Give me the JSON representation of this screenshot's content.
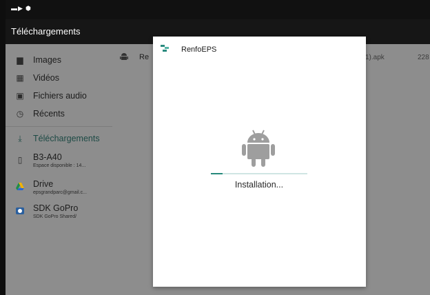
{
  "app_title": "Téléchargements",
  "drawer": {
    "items": [
      {
        "label": "Images",
        "icon": "image-icon"
      },
      {
        "label": "Vidéos",
        "icon": "video-icon"
      },
      {
        "label": "Fichiers audio",
        "icon": "audio-file-icon"
      },
      {
        "label": "Récents",
        "icon": "clock-icon"
      },
      {
        "label": "Téléchargements",
        "icon": "download-icon",
        "active": true
      },
      {
        "label": "B3-A40",
        "sub": "Espace disponible : 14...",
        "icon": "phone-icon"
      },
      {
        "label": "Drive",
        "sub": "epsgrandparc@gmail.c...",
        "icon": "google-drive-icon"
      },
      {
        "label": "SDK GoPro",
        "sub": "SDK GoPro Shared/",
        "icon": "gopro-icon"
      }
    ]
  },
  "file_list": {
    "row": {
      "name_visible": "Re",
      "ext_visible": "1).apk",
      "size_visible": "228",
      "icon": "android-icon"
    }
  },
  "dialog": {
    "app_name": "RenfoEPS",
    "status": "Installation...",
    "progress": 0.12
  },
  "colors": {
    "accent": "#26897b",
    "active_drawer_text": "#1d4a45",
    "scrim_background": "#8d8d8d",
    "appbar": "#161616"
  }
}
